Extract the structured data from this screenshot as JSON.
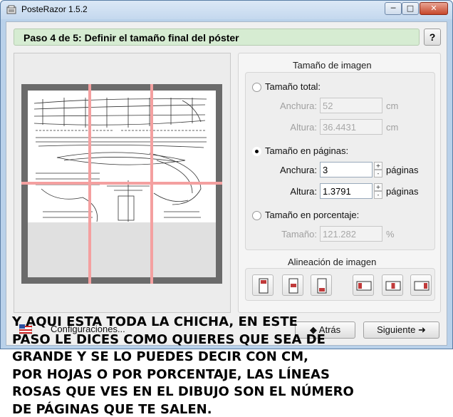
{
  "window": {
    "title": "PosteRazor 1.5.2",
    "min_label": "─",
    "max_label": "□",
    "close_label": "✕"
  },
  "step": {
    "title": "Paso 4 de 5: Definir el tamaño final del póster",
    "help_label": "?"
  },
  "size_panel": {
    "heading": "Tamaño de imagen",
    "total": {
      "label": "Tamaño total:",
      "width_label": "Anchura:",
      "width_value": "52",
      "height_label": "Altura:",
      "height_value": "36.4431",
      "unit": "cm"
    },
    "pages": {
      "label": "Tamaño en páginas:",
      "width_label": "Anchura:",
      "width_value": "3",
      "height_label": "Altura:",
      "height_value": "1.3791",
      "unit": "páginas",
      "spin_up": "+",
      "spin_down": "-"
    },
    "percent": {
      "label": "Tamaño en porcentaje:",
      "size_label": "Tamaño:",
      "size_value": "121.282",
      "unit": "%"
    },
    "selected": "pages"
  },
  "alignment": {
    "heading": "Alineación de imagen",
    "buttons": [
      "top",
      "middle",
      "bottom",
      "left",
      "center",
      "right"
    ]
  },
  "bottom": {
    "settings_label": "Configuraciones...",
    "back_label": "Atrás",
    "next_label": "Siguiente",
    "back_icon": "arrow-left-icon",
    "next_icon": "arrow-right-icon"
  },
  "caption": "Y AQUI ESTA TODA LA CHICHA, EN ESTE\nPASO LE DICES COMO QUIERES QUE SEA DE\nGRANDE Y SE LO PUEDES DECIR CON CM,\nPOR HOJAS O POR PORCENTAJE, LAS LÍNEAS\nROSAS QUE VES EN EL DIBUJO SON EL NÚMERO\nDE PÁGINAS QUE TE SALEN.",
  "colors": {
    "page_guides": "#f4a0a0",
    "step_bar": "#d6ecd2"
  }
}
